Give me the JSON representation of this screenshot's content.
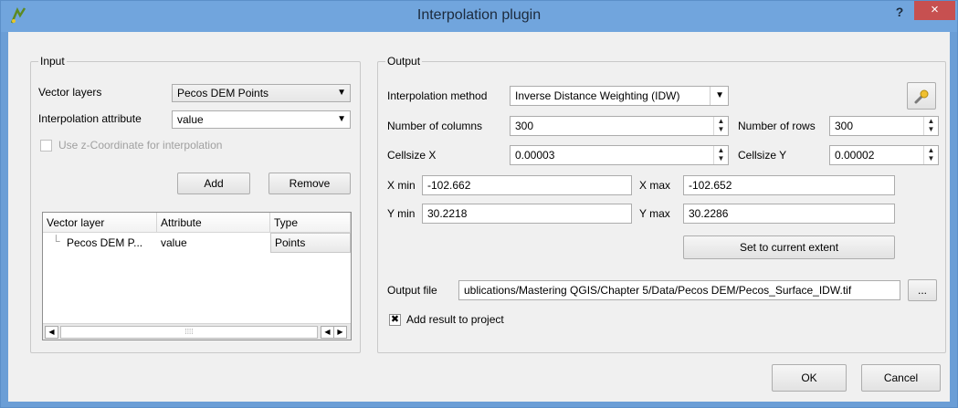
{
  "window": {
    "title": "Interpolation plugin",
    "help_label": "?",
    "close_label": "×"
  },
  "input": {
    "legend": "Input",
    "vector_layers_label": "Vector layers",
    "vector_layers_value": "Pecos DEM Points",
    "interp_attr_label": "Interpolation attribute",
    "interp_attr_value": "value",
    "use_z_label": "Use z-Coordinate for interpolation",
    "add_label": "Add",
    "remove_label": "Remove",
    "table": {
      "columns": [
        "Vector layer",
        "Attribute",
        "Type"
      ],
      "rows": [
        {
          "layer": "Pecos DEM P...",
          "attribute": "value",
          "type": "Points"
        }
      ]
    }
  },
  "output": {
    "legend": "Output",
    "method_label": "Interpolation method",
    "method_value": "Inverse Distance Weighting (IDW)",
    "num_cols_label": "Number of columns",
    "num_cols_value": "300",
    "num_rows_label": "Number of rows",
    "num_rows_value": "300",
    "cellsize_x_label": "Cellsize X",
    "cellsize_x_value": "0.00003",
    "cellsize_y_label": "Cellsize Y",
    "cellsize_y_value": "0.00002",
    "xmin_label": "X min",
    "xmin_value": "-102.662",
    "xmax_label": "X max",
    "xmax_value": "-102.652",
    "ymin_label": "Y min",
    "ymin_value": "30.2218",
    "ymax_label": "Y max",
    "ymax_value": "30.2286",
    "set_extent_label": "Set to current extent",
    "output_file_label": "Output file",
    "output_file_value": "ublications/Mastering QGIS/Chapter 5/Data/Pecos DEM/Pecos_Surface_IDW.tif",
    "browse_label": "...",
    "add_result_label": "Add result to project",
    "add_result_checked": "✖"
  },
  "footer": {
    "ok_label": "OK",
    "cancel_label": "Cancel"
  },
  "icons": {
    "app": "qgis-interpolation-icon",
    "settings": "wrench-icon"
  }
}
